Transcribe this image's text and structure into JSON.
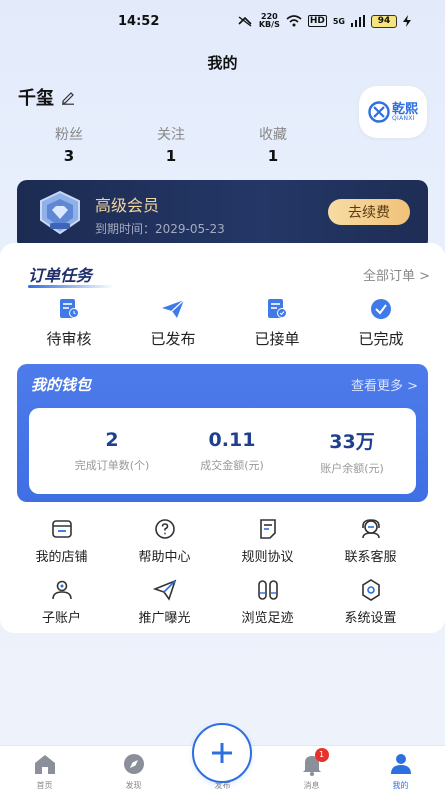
{
  "status_bar": {
    "time": "14:52",
    "net_speed": "220",
    "net_unit": "KB/S",
    "hd": "HD",
    "signal": "5G",
    "battery": "94"
  },
  "header": {
    "title": "我的"
  },
  "user": {
    "name": "千玺"
  },
  "brand": {
    "name_cn": "乾熙",
    "name_en": "QIANXI"
  },
  "stats": [
    {
      "label": "粉丝",
      "value": "3"
    },
    {
      "label": "关注",
      "value": "1"
    },
    {
      "label": "收藏",
      "value": "1"
    }
  ],
  "vip": {
    "title": "高级会员",
    "expire_label": "到期时间：",
    "expire_date": "2029-05-23",
    "renew_label": "去续费"
  },
  "orders": {
    "title": "订单任务",
    "all_label": "全部订单 >",
    "items": [
      {
        "label": "待审核",
        "icon": "pending-review-icon"
      },
      {
        "label": "已发布",
        "icon": "paper-plane-icon"
      },
      {
        "label": "已接单",
        "icon": "accepted-doc-icon"
      },
      {
        "label": "已完成",
        "icon": "check-circle-icon"
      }
    ]
  },
  "wallet": {
    "title": "我的钱包",
    "more_label": "查看更多 >",
    "stats": [
      {
        "value": "2",
        "label": "完成订单数(个)"
      },
      {
        "value": "0.11",
        "label": "成交金额(元)"
      },
      {
        "value": "33万",
        "label": "账户余额(元)"
      }
    ]
  },
  "tools": [
    {
      "label": "我的店铺",
      "icon": "store-icon"
    },
    {
      "label": "帮助中心",
      "icon": "help-icon"
    },
    {
      "label": "规则协议",
      "icon": "document-icon"
    },
    {
      "label": "联系客服",
      "icon": "customer-service-icon"
    },
    {
      "label": "子账户",
      "icon": "sub-account-icon"
    },
    {
      "label": "推广曝光",
      "icon": "promote-icon"
    },
    {
      "label": "浏览足迹",
      "icon": "footprint-icon"
    },
    {
      "label": "系统设置",
      "icon": "settings-icon"
    }
  ],
  "tab_bar": {
    "items": [
      {
        "label": "首页",
        "icon": "home-icon"
      },
      {
        "label": "发现",
        "icon": "compass-icon"
      },
      {
        "label": "发布",
        "icon": "plus-icon"
      },
      {
        "label": "消息",
        "icon": "bell-icon",
        "badge": "1"
      },
      {
        "label": "我的",
        "icon": "user-icon",
        "active": true
      }
    ]
  },
  "colors": {
    "accent": "#2d6fe0",
    "vip_bg": "#1c2b52",
    "vip_gold": "#f1d59e",
    "wallet_bg": "#4d7bea",
    "badge": "#e8312a"
  }
}
